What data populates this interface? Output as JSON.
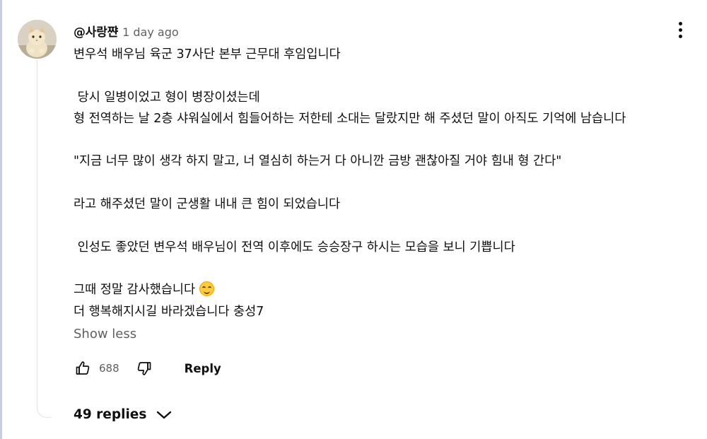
{
  "comment": {
    "author": "@사랑쨘",
    "time": "1 day ago",
    "lines": [
      "변우석 배우님 육군 37사단 본부 근무대 후임입니다",
      "",
      " 당시 일병이었고 형이 병장이셨는데",
      "형 전역하는 날 2층 샤워실에서 힘들어하는 저한테 소대는 달랐지만 해 주셨던 말이 아직도 기억에 남습니다",
      "",
      "\"지금 너무 많이 생각 하지 말고, 너 열심히 하는거 다 아니깐 금방 괜찮아질 거야 힘내 형 간다\"",
      "",
      "라고 해주셨던 말이 군생활 내내 큰 힘이 되었습니다",
      "",
      " 인성도 좋았던 변우석 배우님이 전역 이후에도 승승장구 하시는 모습을 보니 기쁩니다",
      "",
      "그때 정말 감사했습니다",
      "더 행복해지시길 바라겠습니다 충성7"
    ],
    "emoji_after_line_11": "smiling-face-emoji",
    "show_less_label": "Show less",
    "like_count": "688",
    "reply_label": "Reply",
    "replies_label": "49 replies"
  },
  "icons": {
    "menu": "more-vertical-icon",
    "like": "thumbs-up-icon",
    "dislike": "thumbs-down-icon",
    "expand": "chevron-down-icon"
  },
  "colors": {
    "text_primary": "#0f0f0f",
    "text_secondary": "#606060",
    "thread_line": "#e2e2e2"
  }
}
